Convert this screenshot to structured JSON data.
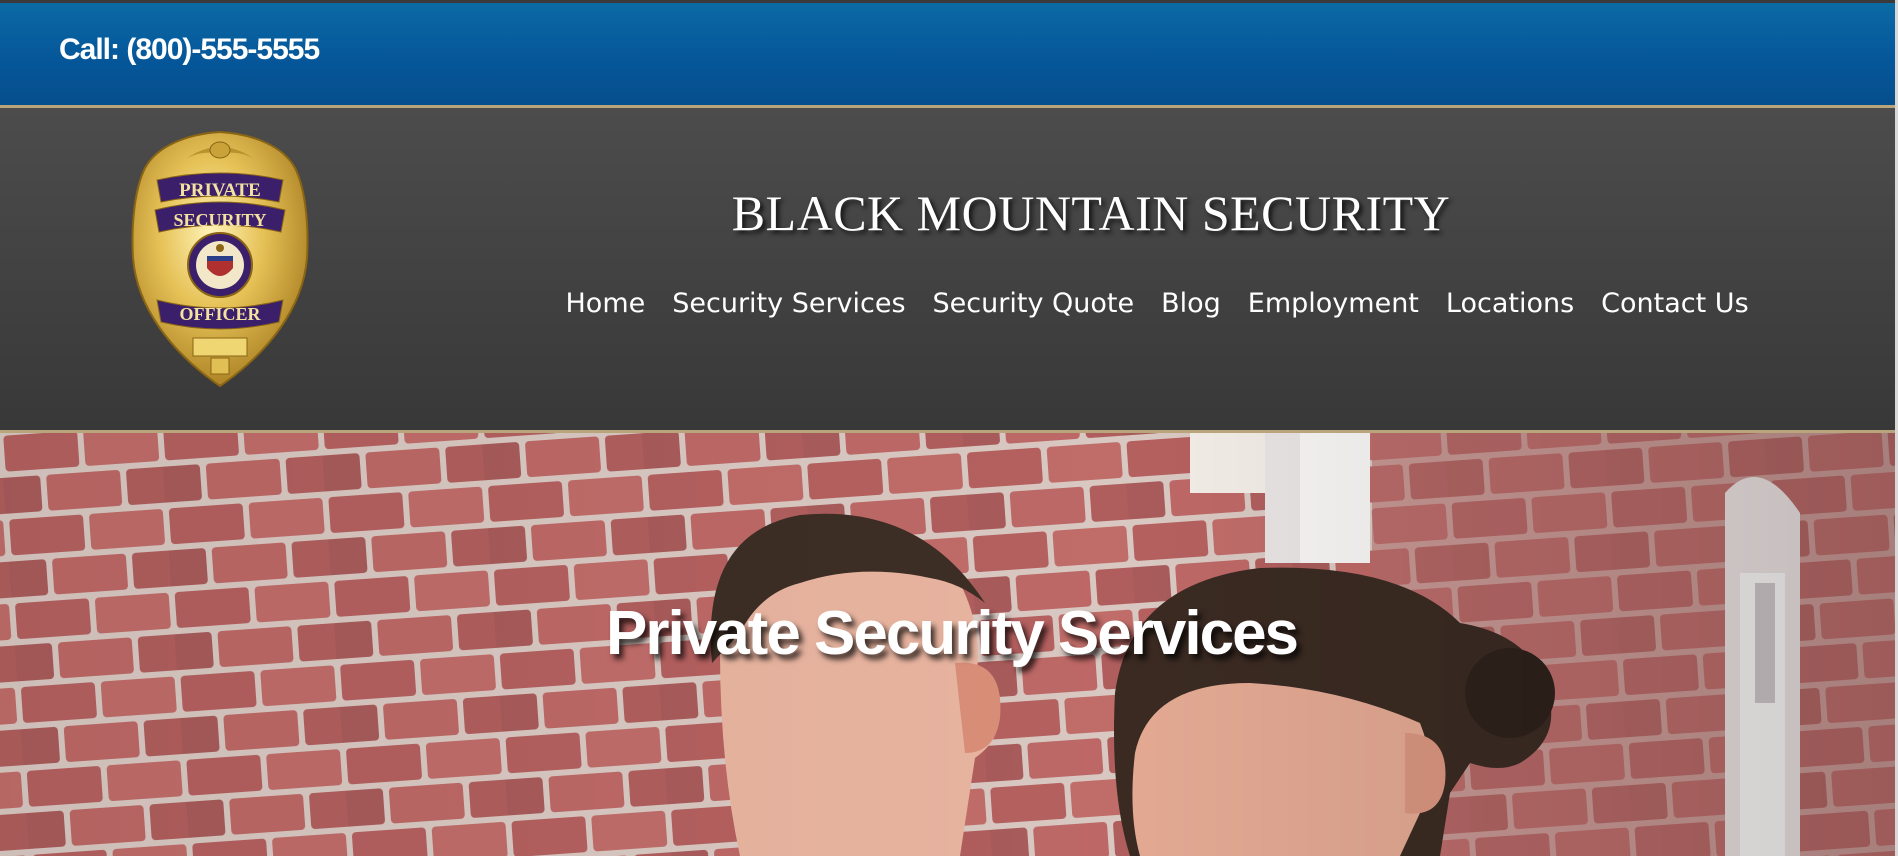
{
  "topbar": {
    "call_text": "Call: (800)-555-5555"
  },
  "header": {
    "site_title": "BLACK MOUNTAIN SECURITY",
    "logo": {
      "icon": "security-badge-icon",
      "text_top": "PRIVATE",
      "text_mid": "SECURITY",
      "text_bottom": "OFFICER"
    },
    "nav": [
      {
        "label": "Home"
      },
      {
        "label": "Security Services"
      },
      {
        "label": "Security Quote"
      },
      {
        "label": "Blog"
      },
      {
        "label": "Employment"
      },
      {
        "label": "Locations"
      },
      {
        "label": "Contact Us"
      }
    ]
  },
  "hero": {
    "title": "Private Security Services",
    "image": "brick-wall-two-people-photo"
  },
  "colors": {
    "topbar": "#05579a",
    "header": "#424242",
    "accent_border": "#b8a57c",
    "badge_gold": "#d9b54a",
    "badge_purple": "#3b1f6b"
  }
}
